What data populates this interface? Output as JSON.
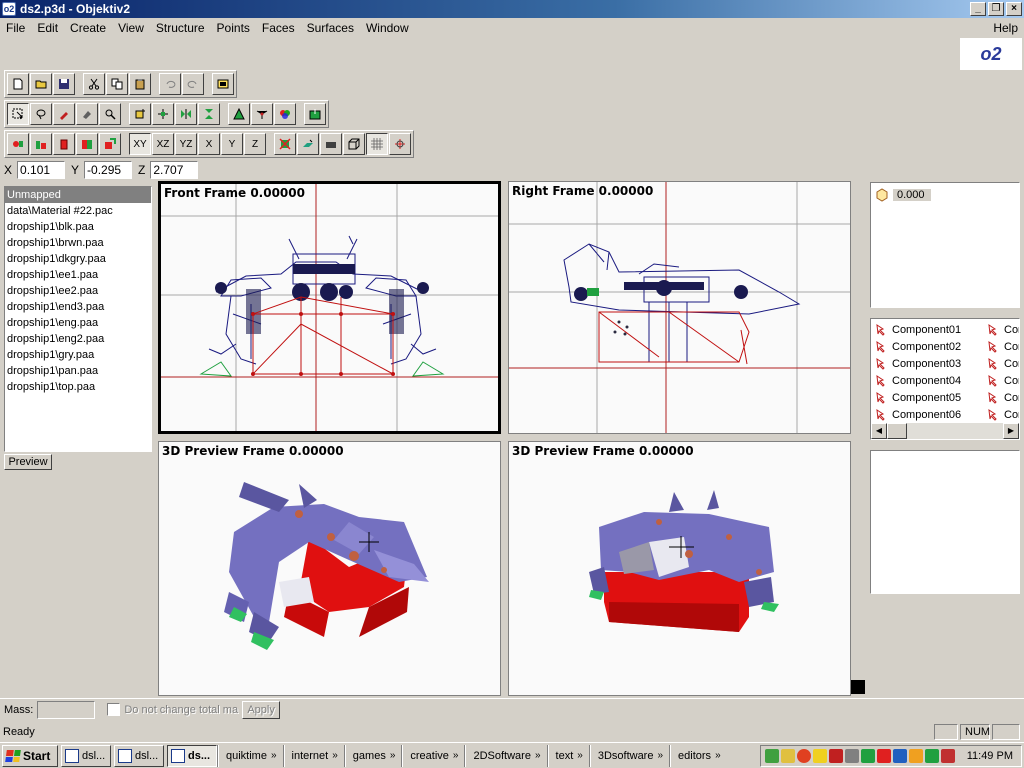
{
  "window": {
    "title": "ds2.p3d - Objektiv2",
    "app_icon": "o2-icon"
  },
  "menu": [
    "File",
    "Edit",
    "Create",
    "View",
    "Structure",
    "Points",
    "Faces",
    "Surfaces",
    "Window"
  ],
  "help_menu": "Help",
  "logo_text": "o2",
  "axis_buttons": [
    "XY",
    "XZ",
    "YZ",
    "X",
    "Y",
    "Z"
  ],
  "coords": {
    "x_label": "X",
    "x": "0.101",
    "y_label": "Y",
    "y": "-0.295",
    "z_label": "Z",
    "z": "2.707"
  },
  "textures": {
    "items": [
      "Unmapped",
      "data\\Material #22.pac",
      "dropship1\\blk.paa",
      "dropship1\\brwn.paa",
      "dropship1\\dkgry.paa",
      "dropship1\\ee1.paa",
      "dropship1\\ee2.paa",
      "dropship1\\end3.paa",
      "dropship1\\eng.paa",
      "dropship1\\eng2.paa",
      "dropship1\\gry.paa",
      "dropship1\\pan.paa",
      "dropship1\\top.paa"
    ],
    "selected_index": 0,
    "preview_button": "Preview"
  },
  "viewports": {
    "front": "Front Frame 0.00000",
    "right": "Right Frame 0.00000",
    "preview_left": "3D Preview Frame 0.00000",
    "preview_right": "3D Preview Frame 0.00000"
  },
  "lod": {
    "value": "0.000"
  },
  "selections": {
    "items": [
      "Component01",
      "Component02",
      "Component03",
      "Component04",
      "Component05",
      "Component06"
    ],
    "second_column": [
      "Com",
      "Com",
      "Com",
      "Com",
      "Com",
      "Com"
    ]
  },
  "mass": {
    "label": "Mass:",
    "value": "",
    "checkbox_label": "Do not change total ma",
    "apply": "Apply"
  },
  "status": {
    "text": "Ready",
    "num": "NUM"
  },
  "taskbar": {
    "start": "Start",
    "tasks": [
      {
        "label": "dsl...",
        "active": false
      },
      {
        "label": "dsl...",
        "active": false
      },
      {
        "label": "ds...",
        "active": true
      }
    ],
    "groups": [
      "quiktime",
      "internet",
      "games",
      "creative",
      "2DSoftware",
      "text",
      "3Dsoftware",
      "editors"
    ],
    "clock": "11:49 PM"
  },
  "colors": {
    "titlebar": "#0a246a",
    "face": "#d4d0c8",
    "model_purple": "#7470c0",
    "model_red": "#e01010",
    "wire_blue": "#1a1a80",
    "wire_red": "#c01010"
  }
}
